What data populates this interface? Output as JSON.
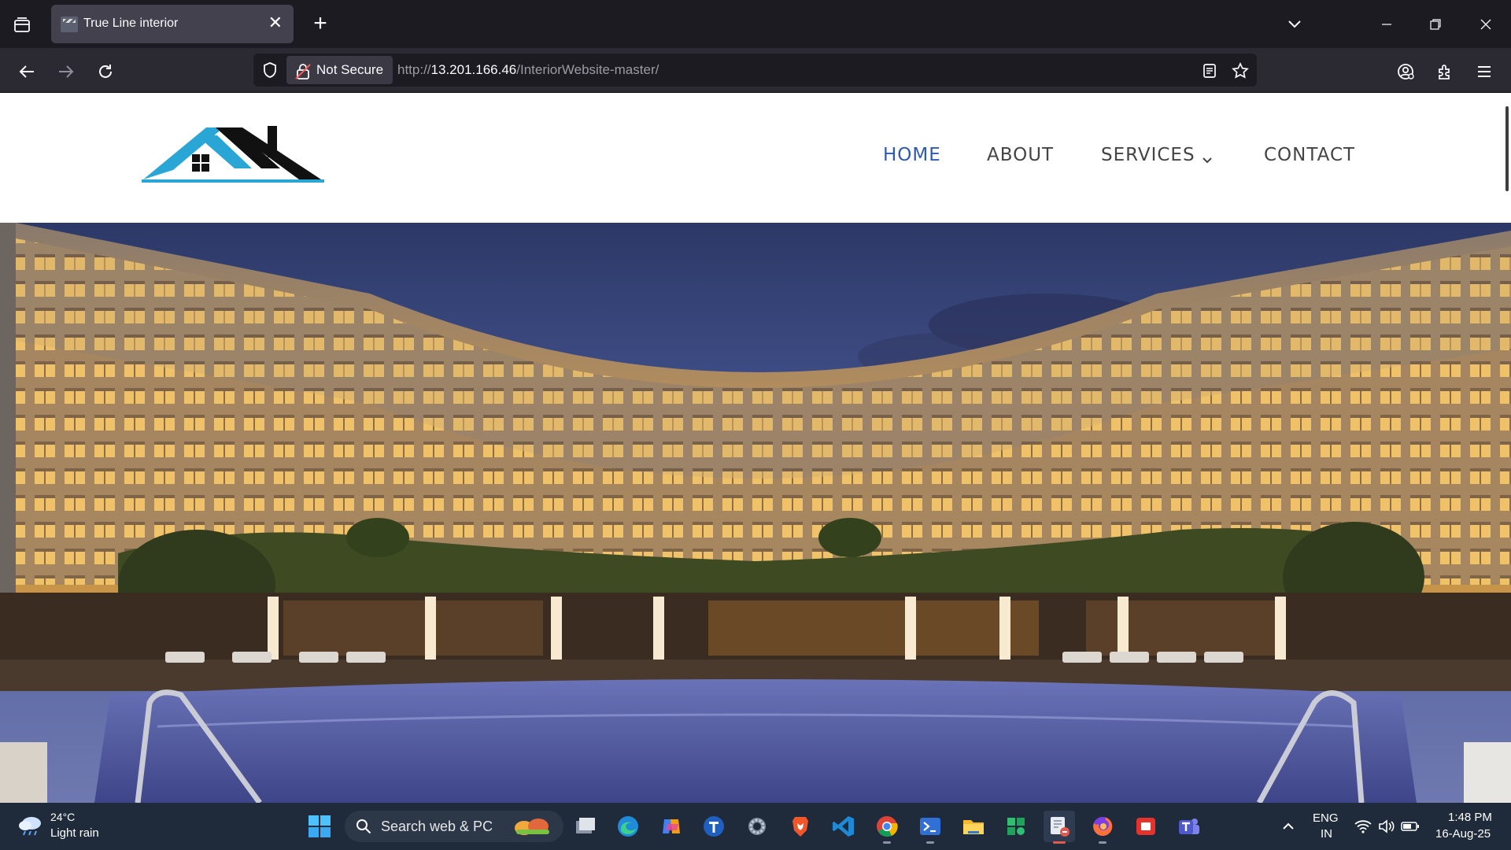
{
  "browser": {
    "tab_title": "True Line interior",
    "url_security_label": "Not Secure",
    "url_prefix": "http://",
    "url_host": "13.201.166.46",
    "url_path": "/InteriorWebsite-master/"
  },
  "site": {
    "nav": {
      "home": "HOME",
      "about": "ABOUT",
      "services": "SERVICES",
      "contact": "CONTACT"
    },
    "colors": {
      "active_nav": "#2f58b5",
      "logo_blue": "#2aa6d6",
      "logo_dark": "#111111"
    }
  },
  "taskbar": {
    "weather_temp": "24°C",
    "weather_desc": "Light rain",
    "search_placeholder": "Search web & PC",
    "lang_line1": "ENG",
    "lang_line2": "IN",
    "time": "1:48 PM",
    "date": "16-Aug-25",
    "apps": [
      "windows-start-icon",
      "task-view-icon",
      "edge-icon",
      "copilot-icon",
      "t-app-icon",
      "settings-icon",
      "brave-icon",
      "vscode-icon",
      "chrome-icon",
      "terminal-icon",
      "file-explorer-icon",
      "green-app-icon",
      "snipping-tool-icon",
      "firefox-icon",
      "red-app-icon",
      "teams-icon"
    ]
  }
}
